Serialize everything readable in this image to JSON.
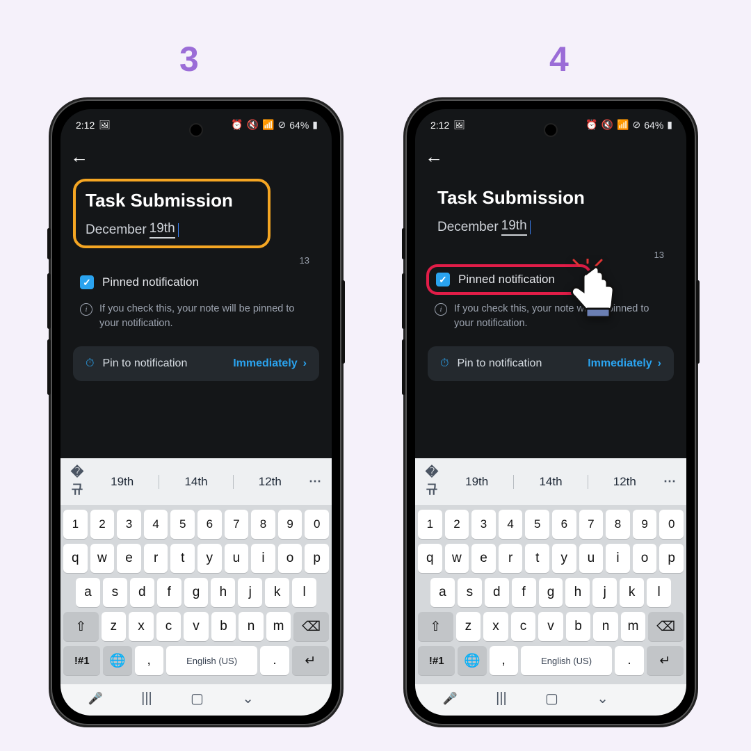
{
  "steps": {
    "s3": "3",
    "s4": "4"
  },
  "status": {
    "time": "2:12",
    "battery": "64%"
  },
  "note": {
    "title": "Task Submission",
    "date_prefix": "December ",
    "date_underlined": "19th",
    "char_count": "13"
  },
  "pinned": {
    "label": "Pinned notification",
    "help": "If you check this, your note will be pinned to your notification."
  },
  "pin_row": {
    "label": "Pin to notification",
    "value": "Immediately"
  },
  "suggestions": {
    "a": "19th",
    "b": "14th",
    "c": "12th"
  },
  "keys": {
    "num": [
      "1",
      "2",
      "3",
      "4",
      "5",
      "6",
      "7",
      "8",
      "9",
      "0"
    ],
    "r1": [
      "q",
      "w",
      "e",
      "r",
      "t",
      "y",
      "u",
      "i",
      "o",
      "p"
    ],
    "r2": [
      "a",
      "s",
      "d",
      "f",
      "g",
      "h",
      "j",
      "k",
      "l"
    ],
    "r3": [
      "z",
      "x",
      "c",
      "v",
      "b",
      "n",
      "m"
    ],
    "sym": "!#1",
    "comma": ",",
    "space": "English (US)",
    "period": "."
  }
}
